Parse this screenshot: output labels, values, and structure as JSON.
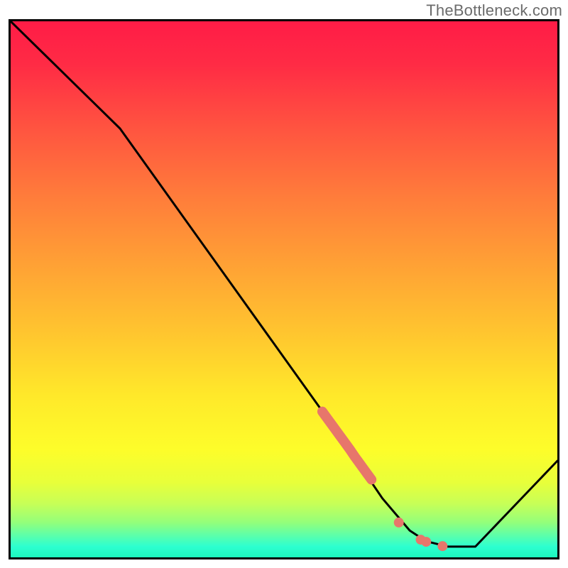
{
  "watermark": "TheBottleneck.com",
  "chart_data": {
    "type": "line",
    "title": "",
    "xlabel": "",
    "ylabel": "",
    "ylim": [
      0,
      100
    ],
    "xlim": [
      0,
      100
    ],
    "series": [
      {
        "name": "curve",
        "x": [
          0,
          20,
          60,
          68,
          73,
          76,
          80,
          85,
          100
        ],
        "y": [
          100,
          80,
          23,
          11,
          5,
          3,
          2,
          2,
          18
        ]
      }
    ],
    "markers": {
      "name": "highlight-segment",
      "color": "#e7766b",
      "x": [
        57,
        58,
        59,
        60,
        61,
        62,
        63,
        64,
        65,
        66,
        71,
        75,
        76,
        79
      ],
      "y": [
        27.2,
        25.8,
        24.4,
        23.0,
        21.6,
        20.2,
        18.7,
        17.3,
        15.9,
        14.5,
        6.5,
        3.3,
        2.9,
        2.1
      ]
    },
    "gradient_stops": [
      {
        "pos": 0,
        "color": "#ff1c46"
      },
      {
        "pos": 50,
        "color": "#ffc52f"
      },
      {
        "pos": 80,
        "color": "#fdfd2a"
      },
      {
        "pos": 100,
        "color": "#1cf7be"
      }
    ]
  },
  "colors": {
    "line": "#000000",
    "marker": "#e7766b",
    "frame": "#000000",
    "watermark": "#6b6b6b"
  }
}
